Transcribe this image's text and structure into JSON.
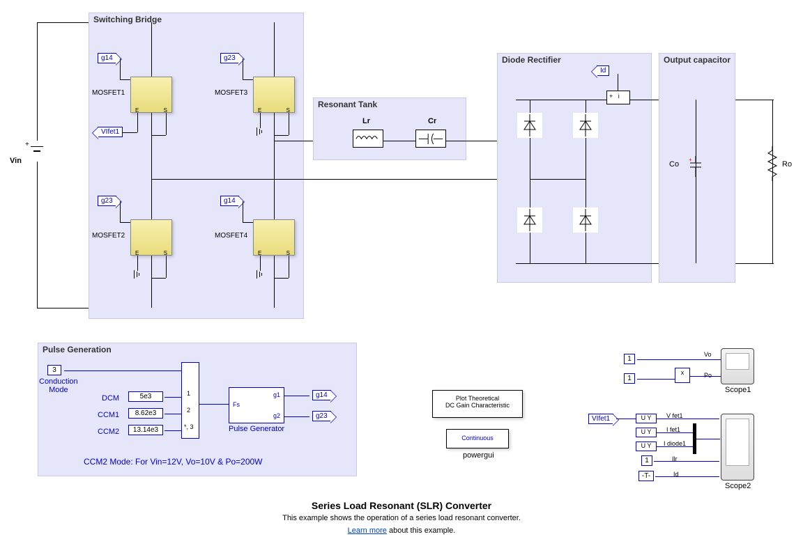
{
  "regions": {
    "switchingBridge": "Switching Bridge",
    "resonantTank": "Resonant Tank",
    "diodeRectifier": "Diode Rectifier",
    "outputCapacitor": "Output capacitor",
    "pulseGeneration": "Pulse Generation"
  },
  "components": {
    "vin": "Vin",
    "mosfet1": "MOSFET1",
    "mosfet2": "MOSFET2",
    "mosfet3": "MOSFET3",
    "mosfet4": "MOSFET4",
    "lr": "Lr",
    "cr": "Cr",
    "co": "Co",
    "ro": "Ro",
    "id": "Id",
    "vifet1_out": "VIfet1",
    "vifet1_in": "VIfet1"
  },
  "tags": {
    "g14": "g14",
    "g23": "g23"
  },
  "mosfet_ports": {
    "e": "E",
    "s": "S"
  },
  "pulseGen": {
    "conductionMode": {
      "value": "3",
      "label": "Conduction\nMode"
    },
    "rows": [
      {
        "mode": "DCM",
        "freq": "5e3",
        "port": "1"
      },
      {
        "mode": "CCM1",
        "freq": "8.62e3",
        "port": "2"
      },
      {
        "mode": "CCM2",
        "freq": "13.14e3",
        "port": "*, 3"
      }
    ],
    "fsLabel": "Fs",
    "pulseGenLabel": "Pulse Generator",
    "g1": "g1",
    "g2": "g2",
    "g14": "g14",
    "g23": "g23",
    "note": "CCM2 Mode: For Vin=12V, Vo=10V & Po=200W"
  },
  "gainBlock": {
    "line1": "Plot Theoretical",
    "line2": "DC Gain Characteristic"
  },
  "powergui": {
    "mode": "Continuous",
    "label": "powergui"
  },
  "scopes": {
    "scope1": {
      "label": "Scope1",
      "signals": {
        "vo": "Vo",
        "po": "Po",
        "x": "x"
      },
      "consts": [
        "1",
        "1"
      ]
    },
    "scope2": {
      "label": "Scope2",
      "signals": {
        "vfet1": "V fet1",
        "ifet1": "I fet1",
        "idiode1": "I diode1",
        "ilr": "Ilr",
        "id": "Id"
      },
      "uy": "U  Y",
      "const1": "1",
      "tblock": "-T-"
    }
  },
  "footer": {
    "title": "Series Load Resonant (SLR) Converter",
    "desc": "This example shows the operation of a series load resonant converter.",
    "learnMore": "Learn more",
    "learnMoreRest": " about this example."
  }
}
